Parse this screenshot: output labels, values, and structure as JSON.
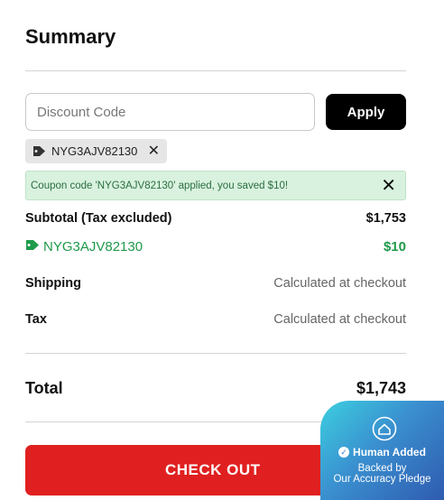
{
  "summary": {
    "title": "Summary"
  },
  "discount": {
    "placeholder": "Discount Code",
    "apply_label": "Apply",
    "applied_code": "NYG3AJV82130"
  },
  "alert": {
    "message": "Coupon code 'NYG3AJV82130' applied, you saved $10!"
  },
  "totals": {
    "subtotal_label": "Subtotal (Tax excluded)",
    "subtotal_value": "$1,753",
    "discount_code": "NYG3AJV82130",
    "discount_value": "$10",
    "shipping_label": "Shipping",
    "shipping_value": "Calculated at checkout",
    "tax_label": "Tax",
    "tax_value": "Calculated at checkout",
    "total_label": "Total",
    "total_value": "$1,743"
  },
  "checkout": {
    "label": "CHECK OUT"
  },
  "badge": {
    "line1": "Human Added",
    "line2": "Backed by",
    "line3": "Our Accuracy Pledge"
  },
  "colors": {
    "checkout_red": "#e02020",
    "discount_green": "#1f9a4b",
    "alert_bg": "#d9f2df"
  }
}
